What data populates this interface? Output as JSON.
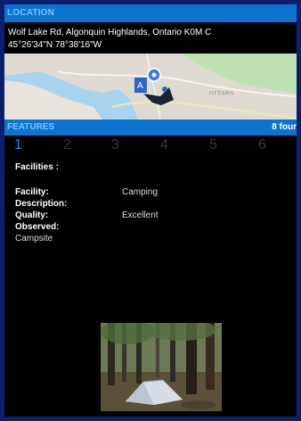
{
  "location": {
    "header": "LOCATION",
    "address": "Wolf Lake Rd, Algonquin Highlands, Ontario K0M C",
    "coordinates": "45°26'34\"N 78°38'16\"W",
    "map_label": "OTTAWA"
  },
  "features": {
    "header": "FEATURES",
    "count": "8 four",
    "pages": [
      "1",
      "2",
      "3",
      "4",
      "5",
      "6"
    ],
    "active_page": "1",
    "facilities_label": "Facilities :",
    "fields": [
      {
        "key": "Facility:",
        "value": "Camping"
      },
      {
        "key": "Description:",
        "value": ""
      },
      {
        "key": "Quality:",
        "value": "Excellent"
      },
      {
        "key": "Observed:",
        "value": ""
      }
    ],
    "observed_value": "Campsite"
  },
  "colors": {
    "accent": "#0c74cf",
    "background": "#000000",
    "outer": "#0b1f6e"
  }
}
